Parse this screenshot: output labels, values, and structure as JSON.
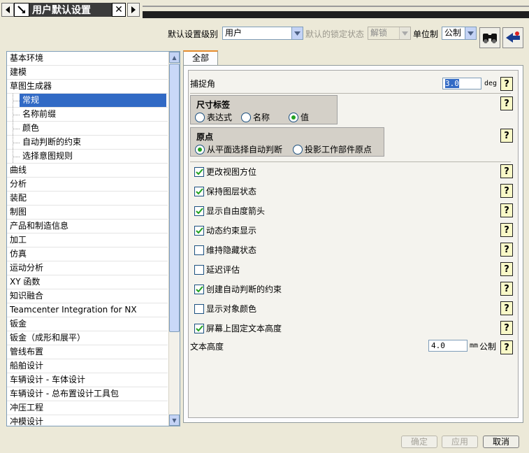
{
  "window": {
    "title": "用户默认设置"
  },
  "toolbar": {
    "level_label": "默认设置级别",
    "level_value": "用户",
    "lock_label": "默认的锁定状态",
    "lock_value": "解锁",
    "unit_label": "单位制",
    "unit_value": "公制"
  },
  "sidebar": {
    "items": [
      {
        "label": "基本环境"
      },
      {
        "label": "建模"
      },
      {
        "label": "草图生成器"
      },
      {
        "label": "常规"
      },
      {
        "label": "名称前缀"
      },
      {
        "label": "颜色"
      },
      {
        "label": "自动判断的约束"
      },
      {
        "label": "选择意图规则"
      },
      {
        "label": "曲线"
      },
      {
        "label": "分析"
      },
      {
        "label": "装配"
      },
      {
        "label": "制图"
      },
      {
        "label": "产品和制造信息"
      },
      {
        "label": "加工"
      },
      {
        "label": "仿真"
      },
      {
        "label": "运动分析"
      },
      {
        "label": "XY 函数"
      },
      {
        "label": "知识融合"
      },
      {
        "label": "Teamcenter Integration for NX"
      },
      {
        "label": "钣金"
      },
      {
        "label": "钣金（成形和展平）"
      },
      {
        "label": "管线布置"
      },
      {
        "label": "船舶设计"
      },
      {
        "label": "车辆设计 - 车体设计"
      },
      {
        "label": "车辆设计 - 总布置设计工具包"
      },
      {
        "label": "冲压工程"
      },
      {
        "label": "冲模设计"
      }
    ],
    "selected": "常规"
  },
  "tabs": [
    {
      "label": "全部"
    }
  ],
  "settings": {
    "snap_angle": {
      "label": "捕捉角",
      "value": "3.0",
      "unit": "deg"
    },
    "dimension_label": {
      "title": "尺寸标签",
      "options": [
        "表达式",
        "名称",
        "值"
      ],
      "selected": "值"
    },
    "origin": {
      "title": "原点",
      "options": [
        "从平面选择自动判断",
        "投影工作部件原点"
      ],
      "selected": "从平面选择自动判断"
    },
    "checks": [
      {
        "label": "更改视图方位",
        "checked": true
      },
      {
        "label": "保持图层状态",
        "checked": true
      },
      {
        "label": "显示自由度箭头",
        "checked": true
      },
      {
        "label": "动态约束显示",
        "checked": true
      },
      {
        "label": "维持隐藏状态",
        "checked": false
      },
      {
        "label": "延迟评估",
        "checked": false
      },
      {
        "label": "创建自动判断的约束",
        "checked": true
      },
      {
        "label": "显示对象颜色",
        "checked": false
      },
      {
        "label": "屏幕上固定文本高度",
        "checked": true
      }
    ],
    "text_height": {
      "label": "文本高度",
      "value": "4.0",
      "unit": "mm",
      "system": "公制"
    }
  },
  "buttons": {
    "ok": "确定",
    "apply": "应用",
    "cancel": "取消"
  },
  "help_glyph": "?"
}
